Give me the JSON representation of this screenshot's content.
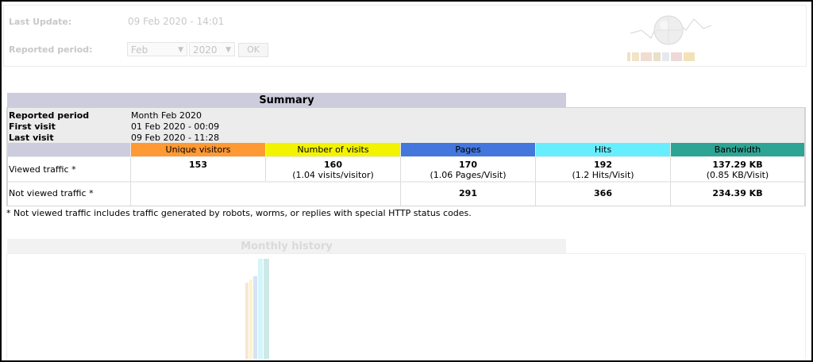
{
  "header": {
    "last_update_label": "Last Update:",
    "last_update_value": "09 Feb 2020 - 14:01",
    "reported_period_label": "Reported period:",
    "month_select": "Feb",
    "year_select": "2020",
    "ok_button": "OK"
  },
  "summary": {
    "title": "Summary",
    "reported_period_label": "Reported period",
    "reported_period_value": "Month Feb 2020",
    "first_visit_label": "First visit",
    "first_visit_value": "01 Feb 2020 - 00:09",
    "last_visit_label": "Last visit",
    "last_visit_value": "09 Feb 2020 - 11:28",
    "columns": [
      {
        "label": "Unique visitors",
        "color": "#ff9933"
      },
      {
        "label": "Number of visits",
        "color": "#f3f300"
      },
      {
        "label": "Pages",
        "color": "#4477dd"
      },
      {
        "label": "Hits",
        "color": "#66eeff"
      },
      {
        "label": "Bandwidth",
        "color": "#2ea495"
      }
    ],
    "viewed": {
      "label": "Viewed traffic *",
      "unique_visitors": "153",
      "visits": "160",
      "visits_sub": "(1.04 visits/visitor)",
      "pages": "170",
      "pages_sub": "(1.06 Pages/Visit)",
      "hits": "192",
      "hits_sub": "(1.2 Hits/Visit)",
      "bandwidth": "137.29 KB",
      "bandwidth_sub": "(0.85 KB/Visit)"
    },
    "not_viewed": {
      "label": "Not viewed traffic *",
      "pages": "291",
      "hits": "366",
      "bandwidth": "234.39 KB"
    },
    "footnote": "* Not viewed traffic includes traffic generated by robots, worms, or replies with special HTTP status codes."
  },
  "monthly_history": {
    "title": "Monthly history"
  }
}
